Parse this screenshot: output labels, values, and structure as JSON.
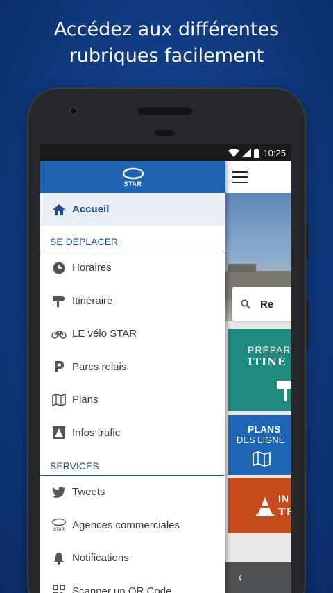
{
  "headline": {
    "line1": "Accédez aux différentes",
    "line2": "rubriques facilement"
  },
  "status_bar": {
    "time": "10:25"
  },
  "drawer": {
    "logo_text": "STAR",
    "home": {
      "label": "Accueil",
      "icon": "home-icon"
    },
    "sections": [
      {
        "title": "SE DÉPLACER",
        "items": [
          {
            "label": "Horaires",
            "icon": "clock-icon"
          },
          {
            "label": "Itinéraire",
            "icon": "signpost-icon"
          },
          {
            "label": "LE vélo STAR",
            "icon": "bicycle-icon"
          },
          {
            "label": "Parcs relais",
            "icon": "parking-icon"
          },
          {
            "label": "Plans",
            "icon": "map-icon"
          },
          {
            "label": "Infos trafic",
            "icon": "traffic-info-icon"
          }
        ]
      },
      {
        "title": "SERVICES",
        "items": [
          {
            "label": "Tweets",
            "icon": "twitter-icon"
          },
          {
            "label": "Agences commerciales",
            "icon": "star-logo-icon"
          },
          {
            "label": "Notifications",
            "icon": "bell-icon"
          },
          {
            "label": "Scanner un QR Code",
            "icon": "qr-code-icon"
          }
        ]
      }
    ]
  },
  "app": {
    "search_text": "Re",
    "tile_teal": {
      "line1": "PRÉPAR",
      "line2": "ITINÉ"
    },
    "tile_blue": {
      "line1": "PLANS",
      "line2": "DES LIGNE"
    },
    "tile_orange": {
      "line1": "IN",
      "line2": "TE"
    },
    "back_glyph": "‹"
  },
  "colors": {
    "background": "#103a80",
    "drawer_header": "#1d63b0",
    "accent_text": "#1d4f8f",
    "tile_teal": "#1f8a80",
    "tile_blue": "#1e66b3",
    "tile_orange": "#c64b1c"
  }
}
